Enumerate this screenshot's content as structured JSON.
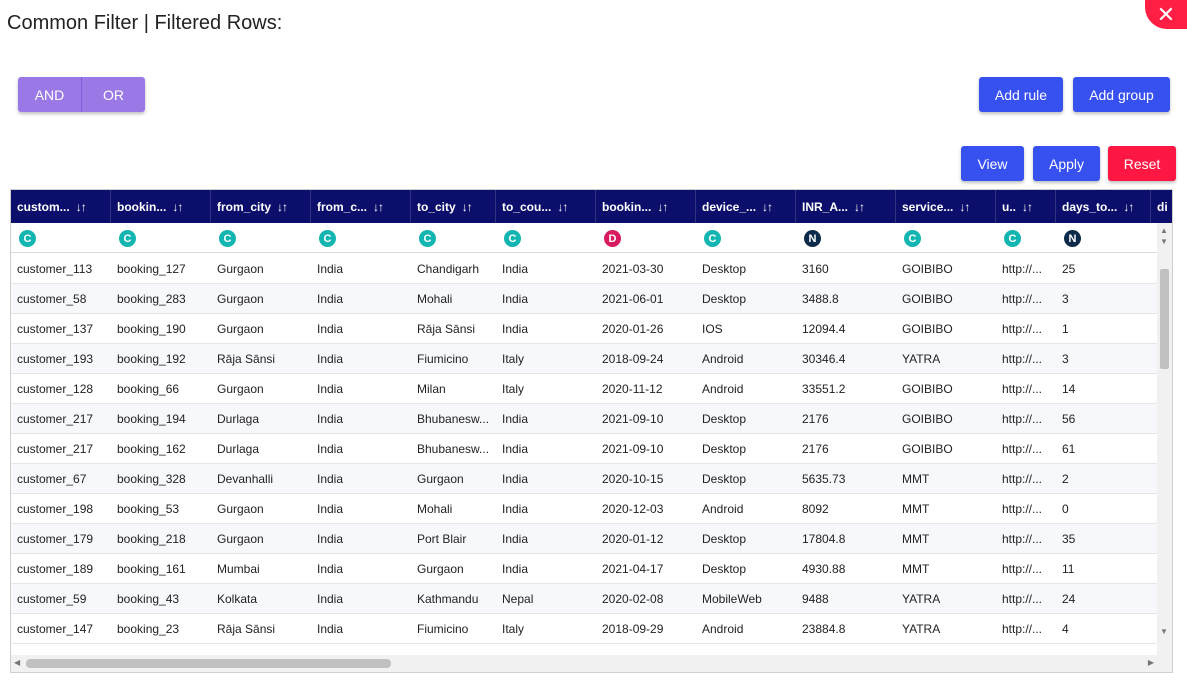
{
  "dialog": {
    "title": "Common Filter | Filtered Rows:",
    "close_label": "✕"
  },
  "toggle": {
    "and_label": "AND",
    "or_label": "OR"
  },
  "actions": {
    "add_rule_label": "Add rule",
    "add_group_label": "Add group",
    "view_label": "View",
    "apply_label": "Apply",
    "reset_label": "Reset"
  },
  "sort_glyph": "↓↑",
  "columns": [
    {
      "label": "custom...",
      "type": "C"
    },
    {
      "label": "bookin...",
      "type": "C"
    },
    {
      "label": "from_city",
      "type": "C"
    },
    {
      "label": "from_c...",
      "type": "C"
    },
    {
      "label": "to_city",
      "type": "C"
    },
    {
      "label": "to_cou...",
      "type": "C"
    },
    {
      "label": "bookin...",
      "type": "D"
    },
    {
      "label": "device_...",
      "type": "C"
    },
    {
      "label": "INR_A...",
      "type": "N"
    },
    {
      "label": "service...",
      "type": "C"
    },
    {
      "label": "u..",
      "type": "C"
    },
    {
      "label": "days_to...",
      "type": "N"
    },
    {
      "label": "di",
      "type": ""
    }
  ],
  "rows": [
    [
      "customer_113",
      "booking_127",
      "Gurgaon",
      "India",
      "Chandigarh",
      "India",
      "2021-03-30",
      "Desktop",
      "3160",
      "GOIBIBO",
      "http://...",
      "25"
    ],
    [
      "customer_58",
      "booking_283",
      "Gurgaon",
      "India",
      "Mohali",
      "India",
      "2021-06-01",
      "Desktop",
      "3488.8",
      "GOIBIBO",
      "http://...",
      "3"
    ],
    [
      "customer_137",
      "booking_190",
      "Gurgaon",
      "India",
      "Rāja Sānsi",
      "India",
      "2020-01-26",
      "IOS",
      "12094.4",
      "GOIBIBO",
      "http://...",
      "1"
    ],
    [
      "customer_193",
      "booking_192",
      "Rāja Sānsi",
      "India",
      "Fiumicino",
      "Italy",
      "2018-09-24",
      "Android",
      "30346.4",
      "YATRA",
      "http://...",
      "3"
    ],
    [
      "customer_128",
      "booking_66",
      "Gurgaon",
      "India",
      "Milan",
      "Italy",
      "2020-11-12",
      "Android",
      "33551.2",
      "GOIBIBO",
      "http://...",
      "14"
    ],
    [
      "customer_217",
      "booking_194",
      "Durlaga",
      "India",
      "Bhubanesw...",
      "India",
      "2021-09-10",
      "Desktop",
      "2176",
      "GOIBIBO",
      "http://...",
      "56"
    ],
    [
      "customer_217",
      "booking_162",
      "Durlaga",
      "India",
      "Bhubanesw...",
      "India",
      "2021-09-10",
      "Desktop",
      "2176",
      "GOIBIBO",
      "http://...",
      "61"
    ],
    [
      "customer_67",
      "booking_328",
      "Devanhalli",
      "India",
      "Gurgaon",
      "India",
      "2020-10-15",
      "Desktop",
      "5635.73",
      "MMT",
      "http://...",
      "2"
    ],
    [
      "customer_198",
      "booking_53",
      "Gurgaon",
      "India",
      "Mohali",
      "India",
      "2020-12-03",
      "Android",
      "8092",
      "MMT",
      "http://...",
      "0"
    ],
    [
      "customer_179",
      "booking_218",
      "Gurgaon",
      "India",
      "Port Blair",
      "India",
      "2020-01-12",
      "Desktop",
      "17804.8",
      "MMT",
      "http://...",
      "35"
    ],
    [
      "customer_189",
      "booking_161",
      "Mumbai",
      "India",
      "Gurgaon",
      "India",
      "2021-04-17",
      "Desktop",
      "4930.88",
      "MMT",
      "http://...",
      "11"
    ],
    [
      "customer_59",
      "booking_43",
      "Kolkata",
      "India",
      "Kathmandu",
      "Nepal",
      "2020-02-08",
      "MobileWeb",
      "9488",
      "YATRA",
      "http://...",
      "24"
    ],
    [
      "customer_147",
      "booking_23",
      "Rāja Sānsi",
      "India",
      "Fiumicino",
      "Italy",
      "2018-09-29",
      "Android",
      "23884.8",
      "YATRA",
      "http://...",
      "4"
    ]
  ],
  "colors": {
    "header_bg": "#0c0e6b",
    "toggle_bg": "#9a78e6",
    "primary_button": "#3750f0",
    "reset_button": "#ff1744",
    "close_button": "#ff1f44",
    "badge_C": "#12b5b0",
    "badge_D": "#d81b60",
    "badge_N": "#0d2a4a"
  }
}
